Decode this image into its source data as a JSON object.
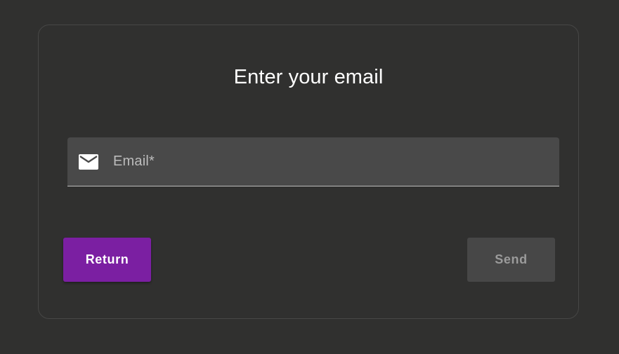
{
  "dialog": {
    "title": "Enter your email"
  },
  "email_field": {
    "label": "Email*",
    "value": "",
    "icon": "mail-icon"
  },
  "actions": {
    "return_label": "Return",
    "send_label": "Send"
  },
  "colors": {
    "background": "#30302f",
    "card_border": "#474746",
    "field_background": "#494949",
    "primary_button": "#7b1fa2",
    "disabled_button": "#474747",
    "disabled_text": "#9b9b9b"
  }
}
